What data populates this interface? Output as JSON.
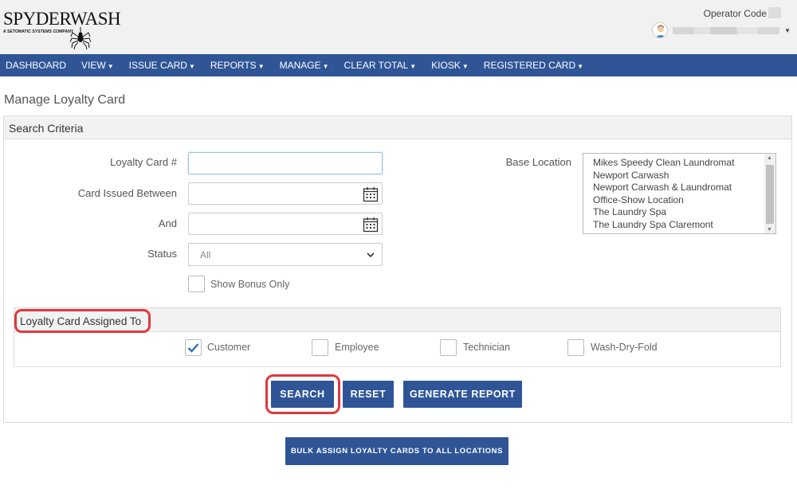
{
  "header": {
    "logo_text": "SPYDERWASH",
    "logo_sub": "A SETOMATIC SYSTEMS COMPANY",
    "operator_label": "Operator Code"
  },
  "nav": {
    "items": [
      {
        "label": "DASHBOARD",
        "dropdown": false
      },
      {
        "label": "VIEW",
        "dropdown": true
      },
      {
        "label": "ISSUE CARD",
        "dropdown": true
      },
      {
        "label": "REPORTS",
        "dropdown": true
      },
      {
        "label": "MANAGE",
        "dropdown": true
      },
      {
        "label": "CLEAR TOTAL",
        "dropdown": true
      },
      {
        "label": "KIOSK",
        "dropdown": true
      },
      {
        "label": "REGISTERED CARD",
        "dropdown": true
      }
    ]
  },
  "page": {
    "title": "Manage Loyalty Card"
  },
  "search": {
    "header": "Search Criteria",
    "loyalty_card_label": "Loyalty Card #",
    "loyalty_card_value": "",
    "issued_between_label": "Card Issued Between",
    "issued_between_value": "",
    "and_label": "And",
    "and_value": "",
    "status_label": "Status",
    "status_value": "All",
    "show_bonus_label": "Show Bonus Only",
    "show_bonus_checked": false,
    "base_location_label": "Base Location",
    "locations": [
      "Mikes Speedy Clean Laundromat",
      "Newport Carwash",
      "Newport Carwash & Laundromat",
      "Office-Show Location",
      "The Laundry Spa",
      "The Laundry Spa Claremont"
    ]
  },
  "assigned": {
    "title": "Loyalty Card Assigned To",
    "options": [
      {
        "label": "Customer",
        "checked": true
      },
      {
        "label": "Employee",
        "checked": false
      },
      {
        "label": "Technician",
        "checked": false
      },
      {
        "label": "Wash-Dry-Fold",
        "checked": false
      }
    ]
  },
  "buttons": {
    "search": "SEARCH",
    "reset": "RESET",
    "generate_report": "GENERATE REPORT",
    "bulk_assign": "BULK ASSIGN LOYALTY CARDS TO ALL LOCATIONS"
  },
  "colors": {
    "nav_bg": "#2f5597",
    "button_bg": "#2f5597",
    "highlight": "#e0383e",
    "check": "#2f6fb8"
  }
}
